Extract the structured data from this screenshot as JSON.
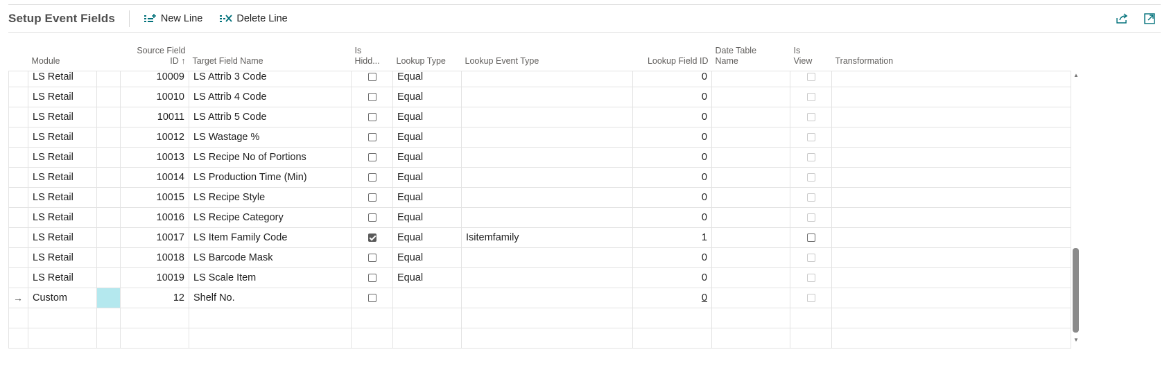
{
  "header": {
    "title": "Setup Event Fields",
    "actions": {
      "new_line": "New Line",
      "delete_line": "Delete Line"
    },
    "icons": [
      "share-icon",
      "expand-icon"
    ]
  },
  "columns": {
    "module": "Module",
    "source_field_id_line1": "Source Field",
    "source_field_id_line2": "ID ↑",
    "target_field_name": "Target Field Name",
    "is_hidden_line1": "Is",
    "is_hidden_line2": "Hidd...",
    "lookup_type": "Lookup Type",
    "lookup_event_type": "Lookup Event Type",
    "lookup_field_id": "Lookup Field ID",
    "date_table_name_line1": "Date Table",
    "date_table_name_line2": "Name",
    "is_view_line1": "Is",
    "is_view_line2": "View",
    "transformation": "Transformation"
  },
  "rows": [
    {
      "module": "LS Retail",
      "source_field_id": "10009",
      "target_field_name": "LS Attrib 3 Code",
      "is_hidden": false,
      "lookup_type": "Equal",
      "lookup_event_type": "",
      "lookup_field_id": "0",
      "is_view": false
    },
    {
      "module": "LS Retail",
      "source_field_id": "10010",
      "target_field_name": "LS Attrib 4 Code",
      "is_hidden": false,
      "lookup_type": "Equal",
      "lookup_event_type": "",
      "lookup_field_id": "0",
      "is_view": false
    },
    {
      "module": "LS Retail",
      "source_field_id": "10011",
      "target_field_name": "LS Attrib 5 Code",
      "is_hidden": false,
      "lookup_type": "Equal",
      "lookup_event_type": "",
      "lookup_field_id": "0",
      "is_view": false
    },
    {
      "module": "LS Retail",
      "source_field_id": "10012",
      "target_field_name": "LS Wastage %",
      "is_hidden": false,
      "lookup_type": "Equal",
      "lookup_event_type": "",
      "lookup_field_id": "0",
      "is_view": false
    },
    {
      "module": "LS Retail",
      "source_field_id": "10013",
      "target_field_name": "LS Recipe No of Portions",
      "is_hidden": false,
      "lookup_type": "Equal",
      "lookup_event_type": "",
      "lookup_field_id": "0",
      "is_view": false
    },
    {
      "module": "LS Retail",
      "source_field_id": "10014",
      "target_field_name": "LS Production Time (Min)",
      "is_hidden": false,
      "lookup_type": "Equal",
      "lookup_event_type": "",
      "lookup_field_id": "0",
      "is_view": false
    },
    {
      "module": "LS Retail",
      "source_field_id": "10015",
      "target_field_name": "LS Recipe Style",
      "is_hidden": false,
      "lookup_type": "Equal",
      "lookup_event_type": "",
      "lookup_field_id": "0",
      "is_view": false
    },
    {
      "module": "LS Retail",
      "source_field_id": "10016",
      "target_field_name": "LS Recipe Category",
      "is_hidden": false,
      "lookup_type": "Equal",
      "lookup_event_type": "",
      "lookup_field_id": "0",
      "is_view": false
    },
    {
      "module": "LS Retail",
      "source_field_id": "10017",
      "target_field_name": "LS Item Family Code",
      "is_hidden": true,
      "lookup_type": "Equal",
      "lookup_event_type": "Isitemfamily",
      "lookup_field_id": "1",
      "is_view": false,
      "is_view_enabled": true
    },
    {
      "module": "LS Retail",
      "source_field_id": "10018",
      "target_field_name": "LS Barcode Mask",
      "is_hidden": false,
      "lookup_type": "Equal",
      "lookup_event_type": "",
      "lookup_field_id": "0",
      "is_view": false
    },
    {
      "module": "LS Retail",
      "source_field_id": "10019",
      "target_field_name": "LS Scale Item",
      "is_hidden": false,
      "lookup_type": "Equal",
      "lookup_event_type": "",
      "lookup_field_id": "0",
      "is_view": false
    },
    {
      "module": "Custom",
      "source_field_id": "12",
      "target_field_name": "Shelf No.",
      "is_hidden": false,
      "lookup_type": "",
      "lookup_event_type": "",
      "lookup_field_id": "0",
      "is_view": false,
      "current": true
    }
  ],
  "current_row_indicator": "→",
  "colors": {
    "accent": "#00707a",
    "focus_cell": "#b4e8ee",
    "title": "#505050"
  }
}
